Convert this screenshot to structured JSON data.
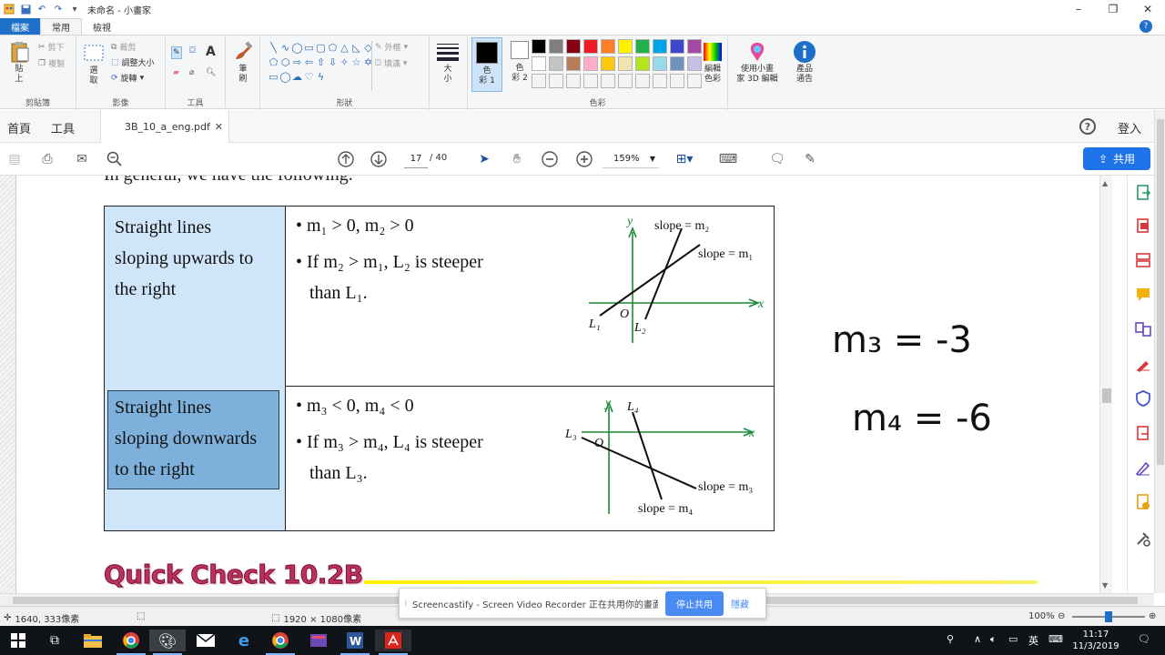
{
  "paint": {
    "title": "未命名 - 小畫家",
    "tabs": [
      "檔案",
      "常用",
      "檢視"
    ],
    "groups": {
      "clipboard": {
        "label": "剪貼簿",
        "paste": "貼\n上",
        "cut": "剪下",
        "copy": "複製"
      },
      "image": {
        "label": "影像",
        "select": "選\n取",
        "crop": "裁剪",
        "resize": "調整大小",
        "rotate": "旋轉"
      },
      "tools": {
        "label": "工具"
      },
      "brush": {
        "label": "筆\n刷"
      },
      "shapes": {
        "label": "形狀",
        "outline": "外框",
        "fill": "填滿"
      },
      "size": {
        "label": "大\n小"
      },
      "colors": {
        "label": "色彩",
        "color1": "色\n彩 1",
        "color2": "色\n彩 2",
        "edit": "編輯\n色彩",
        "color1_value": "#000000",
        "color2_value": "#ffffff",
        "palette": [
          "#000000",
          "#7f7f7f",
          "#880015",
          "#ed1c24",
          "#ff7f27",
          "#fff200",
          "#22b14c",
          "#00a2e8",
          "#3f48cc",
          "#a349a4",
          "#ffffff",
          "#c3c3c3",
          "#b97a57",
          "#ffaec9",
          "#ffc90e",
          "#efe4b0",
          "#b5e61d",
          "#99d9ea",
          "#7092be",
          "#c8bfe7",
          "#f4f4f4",
          "#f4f4f4",
          "#f4f4f4",
          "#f4f4f4",
          "#f4f4f4",
          "#f4f4f4",
          "#f4f4f4",
          "#f4f4f4",
          "#f4f4f4",
          "#f4f4f4"
        ]
      },
      "paint3d": {
        "label": "使用小畫\n家 3D 編輯"
      },
      "notice": {
        "label": "產品\n通告"
      }
    },
    "status": {
      "cursor": "1640, 333像素",
      "canvas": "1920 × 1080像素",
      "zoom": "100%"
    }
  },
  "acrobat": {
    "nav": {
      "home": "首頁",
      "tools": "工具",
      "doc_tab": "3B_10_a_eng.pdf",
      "login": "登入"
    },
    "toolbar": {
      "page_current": "17",
      "page_total": "/ 40",
      "zoom": "159%",
      "share": "共用"
    }
  },
  "doc": {
    "intro": "In general, we have the following.",
    "row1": {
      "label": [
        "Straight lines",
        "sloping upwards to",
        "the right"
      ],
      "bullet1": "• m₁ > 0, m₂ > 0",
      "bullet2a": "• If m₂ > m₁, L₂ is steeper",
      "bullet2b": "than L₁.",
      "graph": {
        "y": "y",
        "x": "x",
        "o": "O",
        "l1": "L₁",
        "l2": "L₂",
        "slope_m2": "slope = m₂",
        "slope_m1": "slope = m₁"
      }
    },
    "row2": {
      "label": [
        "Straight lines",
        "sloping downwards",
        "to the right"
      ],
      "bullet1": "• m₃ < 0, m₄ < 0",
      "bullet2a": "• If m₃ > m₄,  L₄ is steeper",
      "bullet2b": "than L₃.",
      "graph": {
        "y": "y",
        "x": "x",
        "o": "O",
        "l3": "L₃",
        "l4": "L₄",
        "slope_m3": "slope = m₃",
        "slope_m4": "slope = m₄"
      }
    },
    "quick_check": "Quick Check 10.2B",
    "handwriting": [
      "m₃ = -3",
      "m₄ = -6"
    ]
  },
  "screencastify": {
    "message": "Screencastify - Screen Video Recorder 正在共用你的畫面。",
    "stop": "停止共用",
    "hide": "隱藏"
  },
  "taskbar": {
    "time": "11:17",
    "date": "11/3/2019",
    "ime": "英"
  }
}
